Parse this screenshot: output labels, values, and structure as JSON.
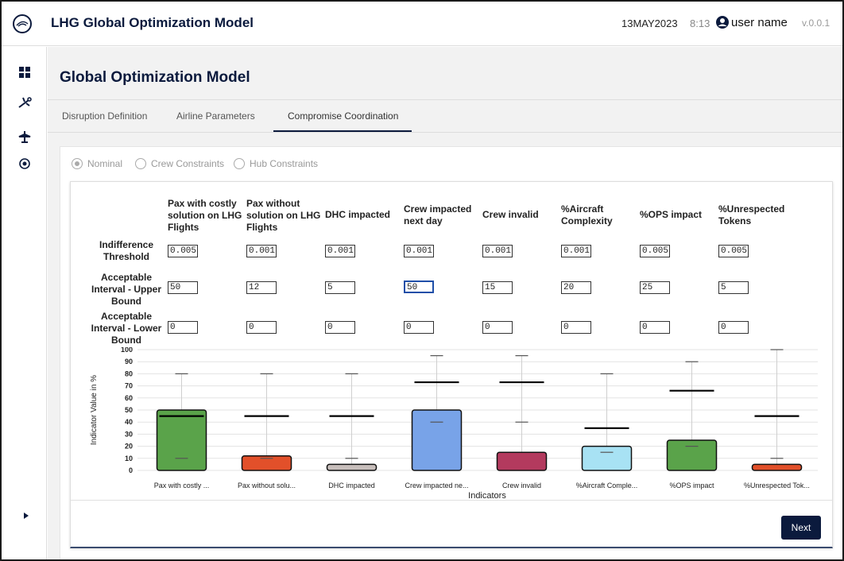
{
  "app": {
    "title": "LHG Global Optimization Model",
    "date": "13MAY2023",
    "time": "8:13",
    "user": "user name",
    "version": "v.0.0.1"
  },
  "page": {
    "title": "Global Optimization Model"
  },
  "tabs": [
    {
      "label": "Disruption Definition"
    },
    {
      "label": "Airline Parameters"
    },
    {
      "label": "Compromise Coordination",
      "active": true
    }
  ],
  "modes": [
    {
      "label": "Nominal",
      "selected": true
    },
    {
      "label": "Crew Constraints",
      "selected": false
    },
    {
      "label": "Hub Constraints",
      "selected": false
    }
  ],
  "columns": [
    "Pax with costly solution on LHG Flights",
    "Pax without solution on LHG Flights",
    "DHC impacted",
    "Crew impacted next day",
    "Crew invalid",
    "%Aircraft Complexity",
    "%OPS impact",
    "%Unrespected Tokens"
  ],
  "rows": {
    "indifference_label": "Indifference Threshold",
    "upper_label": "Acceptable Interval - Upper Bound",
    "lower_label": "Acceptable Interval - Lower Bound"
  },
  "indifference": [
    "0.005",
    "0.001",
    "0.001",
    "0.001",
    "0.001",
    "0.001",
    "0.005",
    "0.005"
  ],
  "upper": [
    "50",
    "12",
    "5",
    "50",
    "15",
    "20",
    "25",
    "5"
  ],
  "lower": [
    "0",
    "0",
    "0",
    "0",
    "0",
    "0",
    "0",
    "0"
  ],
  "chart_data": {
    "type": "bar",
    "ylabel": "Indicator Value in %",
    "xlabel": "Indicators",
    "ylim": [
      0,
      100
    ],
    "yticks": [
      0,
      10,
      20,
      30,
      40,
      50,
      60,
      70,
      80,
      90,
      100
    ],
    "grid": true,
    "categories": [
      "Pax with costly ...",
      "Pax without solu...",
      "DHC impacted",
      "Crew impacted ne...",
      "Crew invalid",
      "%Aircraft Comple...",
      "%OPS impact",
      "%Unrespected Tok..."
    ],
    "values": [
      50,
      12,
      5,
      50,
      15,
      20,
      25,
      5
    ],
    "colors": [
      "#5aa34a",
      "#e2502a",
      "#c8bfbc",
      "#78a3e8",
      "#b33a5e",
      "#a8e2f4",
      "#5aa34a",
      "#e2502a"
    ],
    "max_marker": [
      80,
      80,
      80,
      95,
      95,
      80,
      90,
      100
    ],
    "mean_marker": [
      45,
      45,
      45,
      73,
      73,
      35,
      66,
      45
    ],
    "min_marker": [
      10,
      10,
      10,
      40,
      40,
      15,
      20,
      10
    ]
  },
  "next_label": "Next"
}
